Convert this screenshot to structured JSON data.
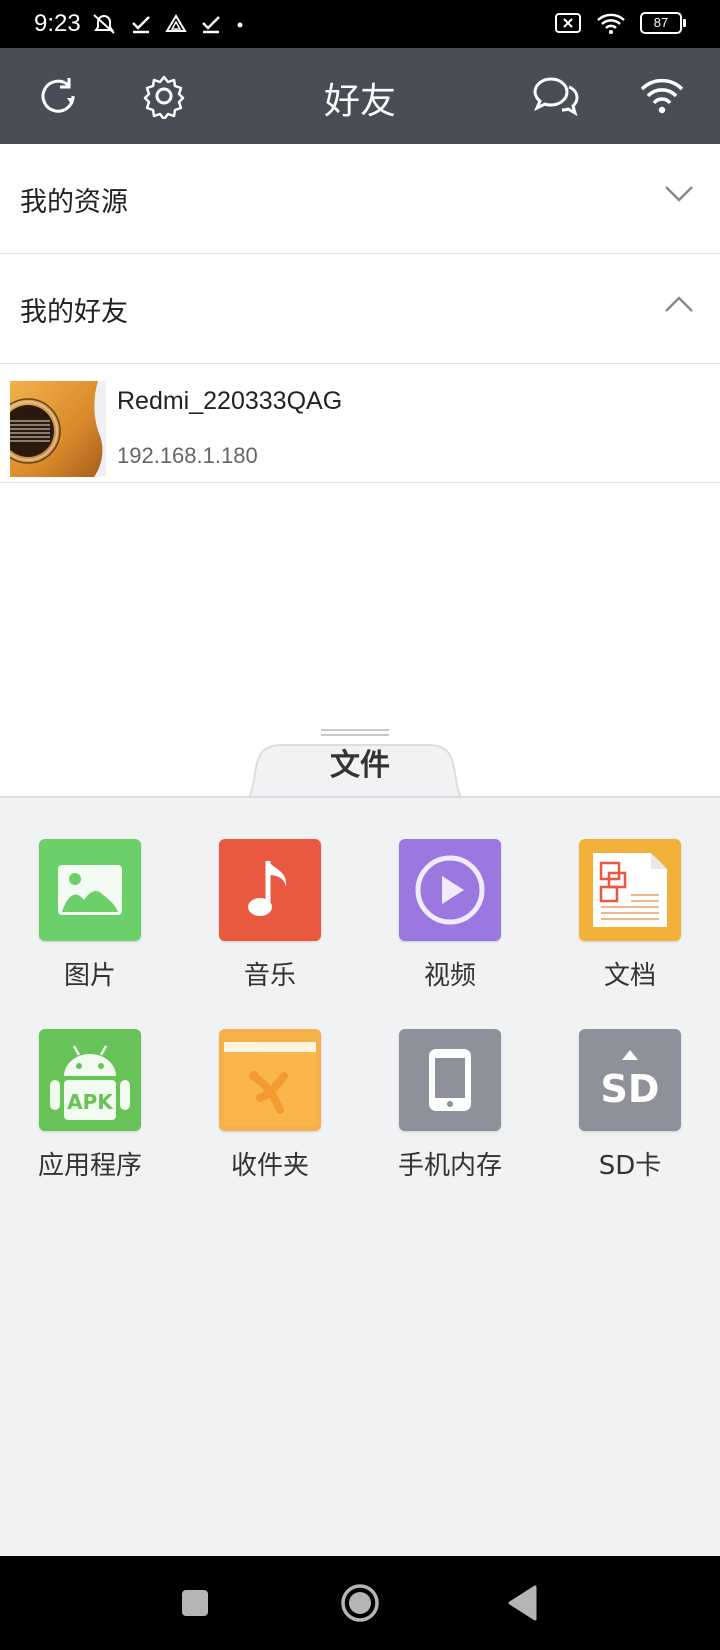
{
  "status_bar": {
    "time": "9:23",
    "battery": "87",
    "icons_left": [
      "mute-icon",
      "check-icon",
      "drive-icon",
      "check-icon",
      "dot-icon"
    ],
    "icons_right": [
      "sim-x-icon",
      "wifi-icon",
      "battery-icon"
    ]
  },
  "app_bar": {
    "title": "好友",
    "bg_color": "#4a4d55"
  },
  "sections": {
    "my_resources": "我的资源",
    "my_friends": "我的好友"
  },
  "friends": [
    {
      "name": "Redmi_220333QAG",
      "ip": "192.168.1.180"
    }
  ],
  "drawer": {
    "tab_label": "文件",
    "items": [
      {
        "label": "图片",
        "icon": "picture-icon",
        "color": "#6bcf6a"
      },
      {
        "label": "音乐",
        "icon": "music-icon",
        "color": "#e8593f"
      },
      {
        "label": "视频",
        "icon": "video-icon",
        "color": "#9a78e0"
      },
      {
        "label": "文档",
        "icon": "document-icon",
        "color": "#f1b23c"
      },
      {
        "label": "应用程序",
        "icon": "android-apk-icon",
        "color": "#67c358"
      },
      {
        "label": "收件夹",
        "icon": "folder-icon",
        "color": "#f5b04a"
      },
      {
        "label": "手机内存",
        "icon": "phone-icon",
        "color": "#8e9199"
      },
      {
        "label": "SD卡",
        "icon": "sd-card-icon",
        "color": "#8e9199"
      }
    ],
    "apk_text": "APK",
    "sd_text": "SD"
  }
}
